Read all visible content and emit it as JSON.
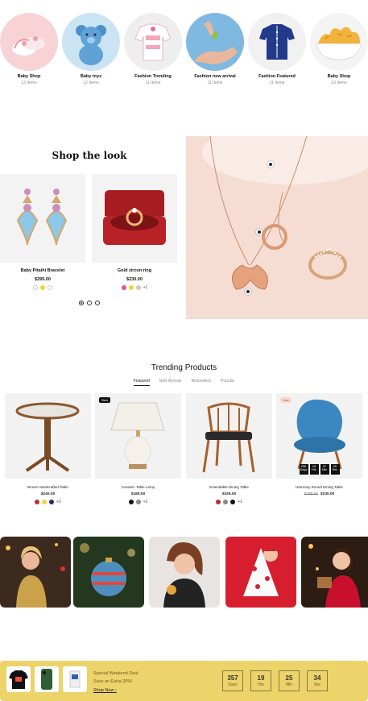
{
  "categories": [
    {
      "name": "Baby Shop",
      "count": "13 Items",
      "bg": "#f7d3d6"
    },
    {
      "name": "Baby toys",
      "count": "12 Items",
      "bg": "#cbe4f3"
    },
    {
      "name": "Fashion Trending",
      "count": "11 Items",
      "bg": "#f3f3f3"
    },
    {
      "name": "Fashion new arrival",
      "count": "11 Items",
      "bg": "#7fb8e0"
    },
    {
      "name": "Fashion Featured",
      "count": "11 Items",
      "bg": "#f1f1f1"
    },
    {
      "name": "Baby Shop",
      "count": "13 Items",
      "bg": "#f4f4f4"
    }
  ],
  "shop_the_look": {
    "title": "Shop the look",
    "products": [
      {
        "name": "Baby Pitaihi Bracelet",
        "price": "$295.00",
        "swatches": [
          "#ffffff",
          "#f2d33b",
          "#ffffff"
        ],
        "more": ""
      },
      {
        "name": "Gold zircon ring",
        "price": "$230.00",
        "swatches": [
          "#ec4f8a",
          "#f2d33b",
          "#cfc6c1"
        ],
        "more": "+1"
      }
    ]
  },
  "trending": {
    "title": "Trending Products",
    "tabs": [
      "Featured",
      "New Arrivals",
      "Bestsellers",
      "Popular"
    ],
    "products": [
      {
        "name": "Brown Handcrafted Table",
        "price": "$240.00",
        "old": "",
        "swatches": [
          "#b8302f",
          "#f2d33b",
          "#1f2a7a"
        ],
        "more": "+2",
        "badge": ""
      },
      {
        "name": "Ceramic Table Lamp",
        "price": "$180.00",
        "old": "",
        "swatches": [
          "#111111",
          "#888888"
        ],
        "more": "+2",
        "badge": "New"
      },
      {
        "name": "Extendable Dining Table",
        "price": "$335.00",
        "old": "",
        "swatches": [
          "#b8302f",
          "#888888",
          "#111111"
        ],
        "more": "+1",
        "badge": ""
      },
      {
        "name": "Harmony Round Dining Table",
        "price": "$230.00",
        "old": "$299.00",
        "swatches": [],
        "more": "",
        "badge": "Sale"
      }
    ],
    "countdown": [
      {
        "n": "998",
        "l": "Days"
      },
      {
        "n": "16",
        "l": "Hrs"
      },
      {
        "n": "37",
        "l": "Min"
      },
      {
        "n": "26",
        "l": "Sec"
      }
    ]
  },
  "deal": {
    "title": "Special Weekend Deal",
    "subtitle": "Save an Extra 20%!",
    "link": "Shop Now",
    "countdown": [
      {
        "n": "357",
        "l": "Days"
      },
      {
        "n": "19",
        "l": "Hrs"
      },
      {
        "n": "25",
        "l": "Min"
      },
      {
        "n": "34",
        "l": "Sec"
      }
    ]
  }
}
